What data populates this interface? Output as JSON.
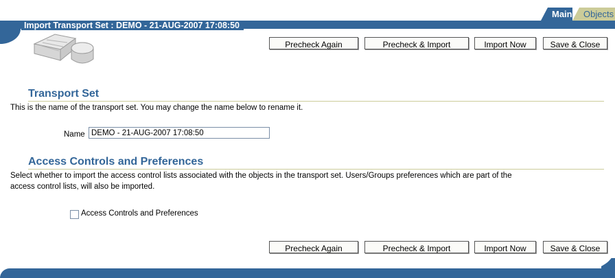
{
  "tabs": {
    "main": "Main",
    "objects": "Objects"
  },
  "header": {
    "title": "Import Transport Set : DEMO - 21-AUG-2007 17:08:50"
  },
  "buttons": {
    "precheck_again": "Precheck Again",
    "precheck_import": "Precheck & Import",
    "import_now": "Import Now",
    "save_close": "Save & Close"
  },
  "transport_set": {
    "title": "Transport Set",
    "description": "This is the name of the transport set. You may change the name below to rename it.",
    "name_label": "Name",
    "name_value": "DEMO - 21-AUG-2007 17:08:50"
  },
  "access": {
    "title": "Access Controls and Preferences",
    "description_line1": "Select whether to import the access control lists associated with the objects in the transport set. Users/Groups preferences which are part of the",
    "description_line2": "access control lists, will also be imported.",
    "checkbox_label": "Access Controls and Preferences",
    "checked": false
  },
  "icons": {
    "logo": "import-transport-logo-icon"
  },
  "colors": {
    "brand": "#336699",
    "accent": "#cccc99"
  }
}
